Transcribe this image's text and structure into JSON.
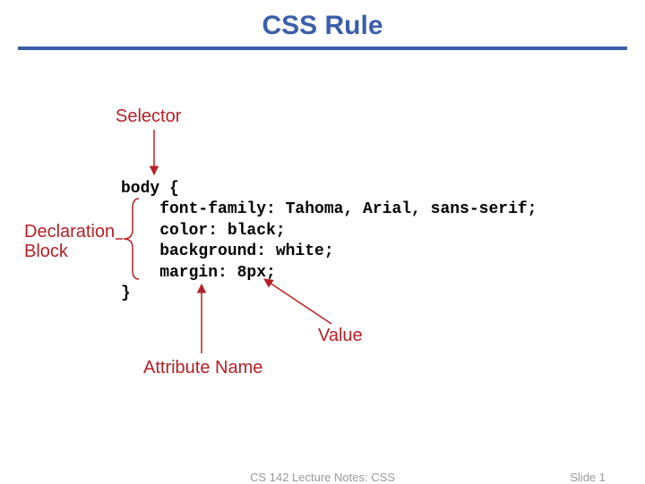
{
  "title": "CSS Rule",
  "labels": {
    "selector": "Selector",
    "declaration_block": "Declaration\nBlock",
    "attribute_name": "Attribute Name",
    "value": "Value"
  },
  "code": {
    "line1": "body {",
    "line2": "    font-family: Tahoma, Arial, sans-serif;",
    "line3": "    color: black;",
    "line4": "    background: white;",
    "line5": "    margin: 8px;",
    "line6": "}"
  },
  "footer": {
    "course": "CS 142 Lecture Notes: CSS",
    "slide": "Slide 1"
  },
  "colors": {
    "accent": "#3a5fab",
    "label": "#b52025"
  }
}
